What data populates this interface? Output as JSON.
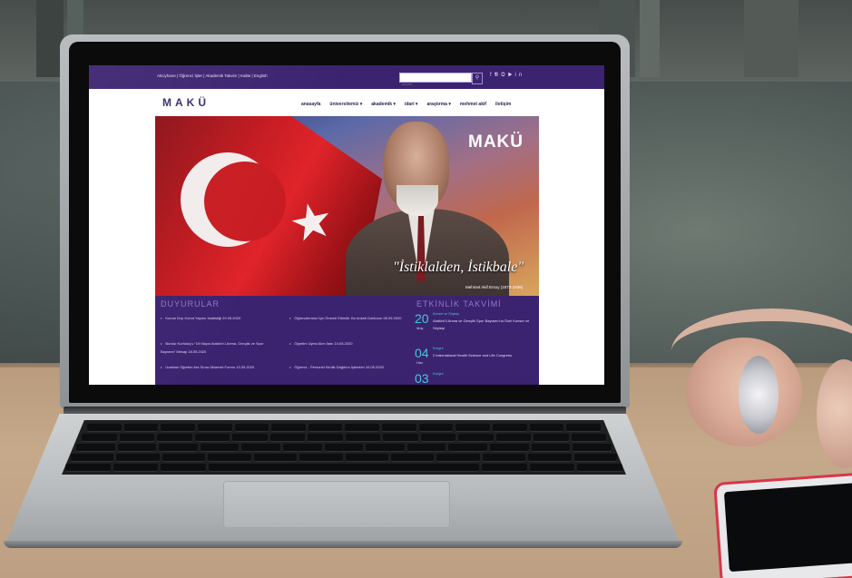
{
  "website": {
    "top_links": "Akciyhane | Öğrenci İşler | Akademik Takvim | Kalite | English",
    "search": {
      "placeholder": "arama",
      "button_icon": "search-icon"
    },
    "social_icons": [
      "facebook-icon",
      "twitter-icon",
      "instagram-icon",
      "youtube-icon",
      "linkedin-icon"
    ],
    "logo": "MAKÜ",
    "nav": [
      {
        "label": "anasayfa"
      },
      {
        "label": "üniversitemiz ▾"
      },
      {
        "label": "akademik ▾"
      },
      {
        "label": "idari ▾"
      },
      {
        "label": "araştırma ▾"
      },
      {
        "label": "mehmet akif"
      },
      {
        "label": "iletişim"
      }
    ],
    "hero": {
      "logo": "MAKÜ",
      "quote": "\"İstiklalden, İstikbale\"",
      "quote_by": "Mehmet Akif Ersoy (1873-1936)"
    },
    "announcements": {
      "title": "DUYURULAR",
      "items": [
        {
          "text": "Kurum Dışı Konut Yapımı İstatistiği 29.05.2020"
        },
        {
          "text": "Öğrencilerimiz İçin Önemli Etkinlik: Bu Anketi Doldurun 06.05.2020"
        },
        {
          "text": "Burdur Kurtuluş’u “19 Mayıs Atatürk’ü Anma, Gençlik ve Spor Bayramı” Mesajı 18.05.2020"
        },
        {
          "text": "Öğretim Üyesi Alım İlanı 14.05.2020"
        },
        {
          "text": "Uzaktan Öğretim Ara Sınav Mazeret Formu 13.05.2020"
        },
        {
          "text": "Öğrenci - Personel Kimlik Dağıtımı İşlemleri 10.05.2020"
        }
      ]
    },
    "events": {
      "title": "ETKİNLİK TAKVİMİ",
      "items": [
        {
          "day": "20",
          "month": "May",
          "category": "Konser ve Söyleşi",
          "title": "Atatürk’ü Anma ve Gençlik Spor Bayramı’na Özel Konser ve Söyleşi"
        },
        {
          "day": "04",
          "month": "Haz",
          "category": "Kongre",
          "title": "2.International Health Science and Life Congress"
        },
        {
          "day": "03",
          "month": "",
          "category": "Kongre",
          "title": ""
        }
      ]
    }
  }
}
